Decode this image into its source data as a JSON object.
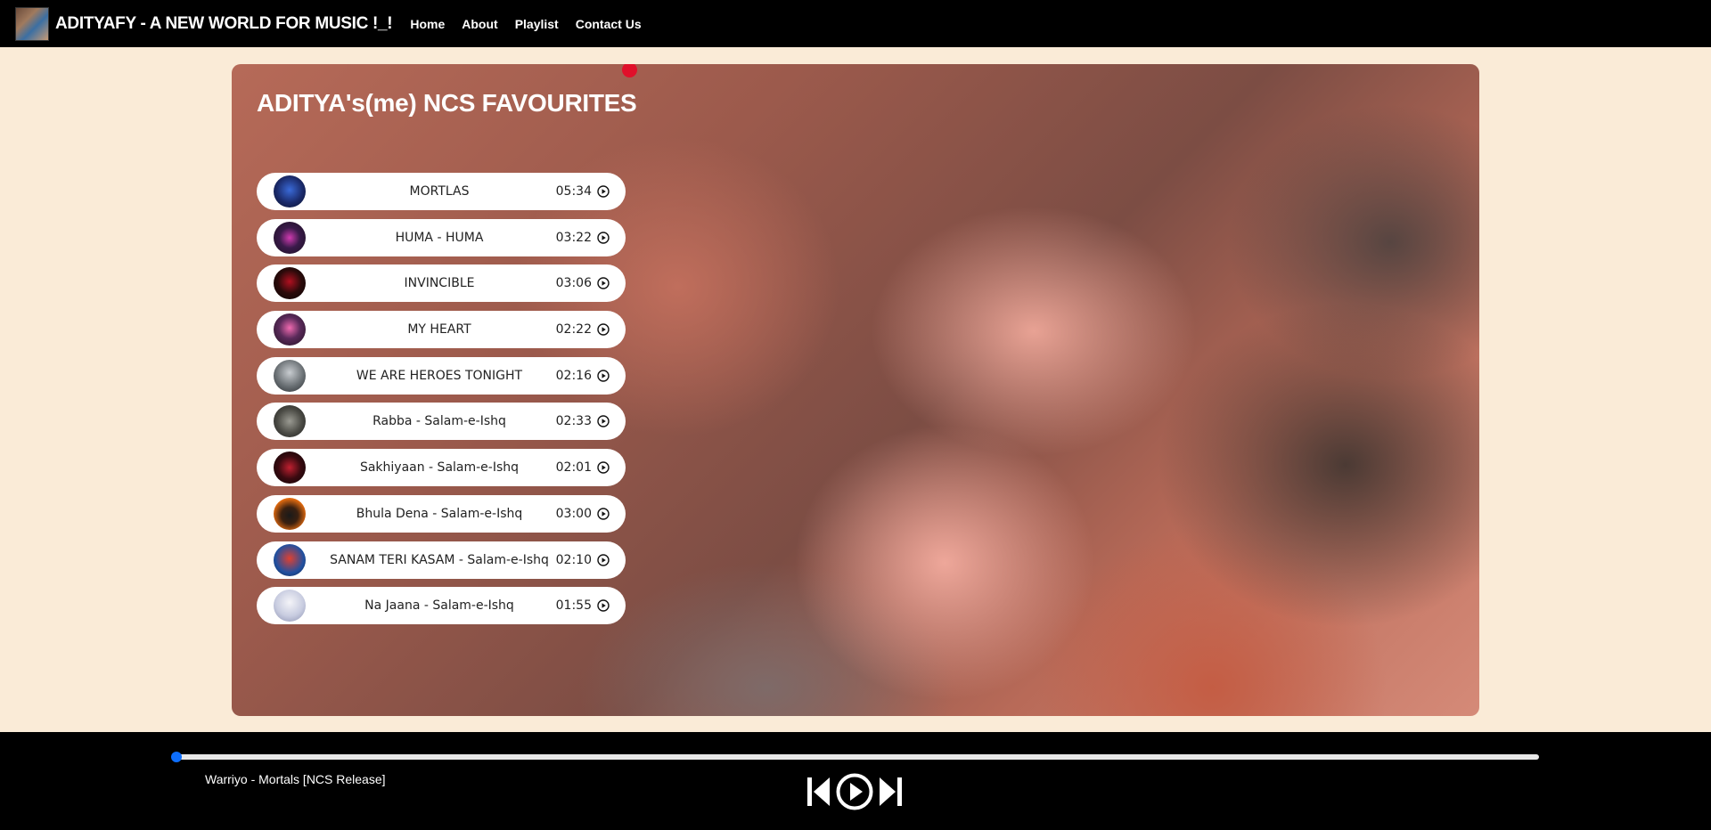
{
  "nav": {
    "brand": "ADITYAFY - A NEW WORLD FOR MUSIC !_!",
    "links": [
      "Home",
      "About",
      "Playlist",
      "Contact Us"
    ]
  },
  "main": {
    "title": "ADITYA's(me) NCS FAVOURITES",
    "songs": [
      {
        "name": "MORTLAS",
        "duration": "05:34"
      },
      {
        "name": "HUMA - HUMA",
        "duration": "03:22"
      },
      {
        "name": "INVINCIBLE",
        "duration": "03:06"
      },
      {
        "name": "MY HEART",
        "duration": "02:22"
      },
      {
        "name": "WE ARE HEROES TONIGHT",
        "duration": "02:16"
      },
      {
        "name": "Rabba - Salam-e-Ishq",
        "duration": "02:33"
      },
      {
        "name": "Sakhiyaan - Salam-e-Ishq",
        "duration": "02:01"
      },
      {
        "name": "Bhula Dena - Salam-e-Ishq",
        "duration": "03:00"
      },
      {
        "name": "SANAM TERI KASAM - Salam-e-Ishq",
        "duration": "02:10"
      },
      {
        "name": "Na Jaana - Salam-e-Ishq",
        "duration": "01:55"
      }
    ]
  },
  "player": {
    "now_playing": "Warriyo - Mortals [NCS Release]",
    "progress": 0,
    "accent_color": "#0d6efd"
  },
  "icons": {
    "prev": "skip-back-icon",
    "play": "play-circle-icon",
    "next": "skip-forward-icon",
    "song_play": "play-circle-icon"
  }
}
